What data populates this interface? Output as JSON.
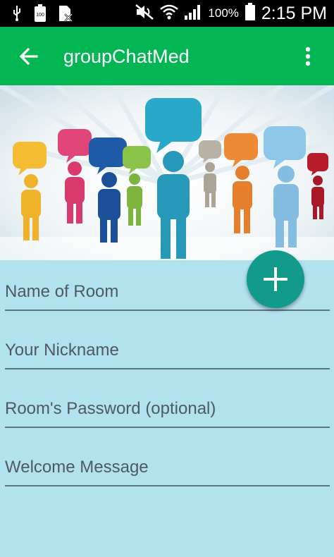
{
  "status_bar": {
    "battery_percent": "100%",
    "time": "2:15 PM",
    "icons": [
      "usb-icon",
      "battery-saver-icon",
      "no-sim-icon",
      "mute-icon",
      "wifi-icon",
      "signal-icon",
      "battery-icon"
    ]
  },
  "app_bar": {
    "title": "groupChatMed",
    "background": "#04b553"
  },
  "form": {
    "room_name_placeholder": "Name of Room",
    "nickname_placeholder": "Your Nickname",
    "password_placeholder": "Room's Password (optional)",
    "welcome_placeholder": "Welcome Message"
  },
  "fab": {
    "icon": "plus-icon",
    "color": "#129b8b"
  },
  "colors": {
    "form_background": "#b3e2ef"
  }
}
